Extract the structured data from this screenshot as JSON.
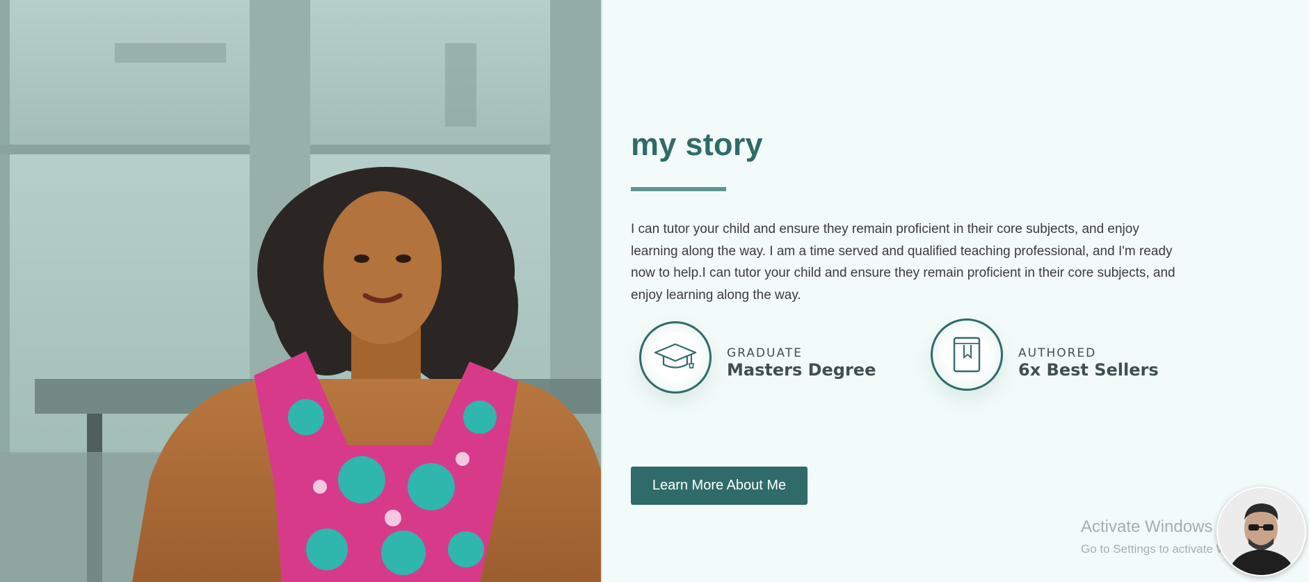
{
  "story": {
    "title": "my story",
    "body": "I can tutor your child and ensure they remain proficient in their core subjects, and enjoy learning along the way. I am a time served and qualified teaching professional, and I'm ready now to help.I can tutor your child and ensure they remain proficient in their core subjects, and enjoy learning along the way."
  },
  "features": [
    {
      "eyebrow": "GRADUATE",
      "headline": "Masters Degree",
      "icon": "graduation-cap-icon"
    },
    {
      "eyebrow": "AUTHORED",
      "headline": "6x Best Sellers",
      "icon": "book-icon"
    }
  ],
  "cta": {
    "label": "Learn More About Me"
  },
  "watermark": {
    "line1": "Activate Windows",
    "line2": "Go to Settings to activate Windows."
  },
  "colors": {
    "accent": "#2f6b68",
    "background": "#f2fbf9",
    "text": "#3b3b3b"
  }
}
